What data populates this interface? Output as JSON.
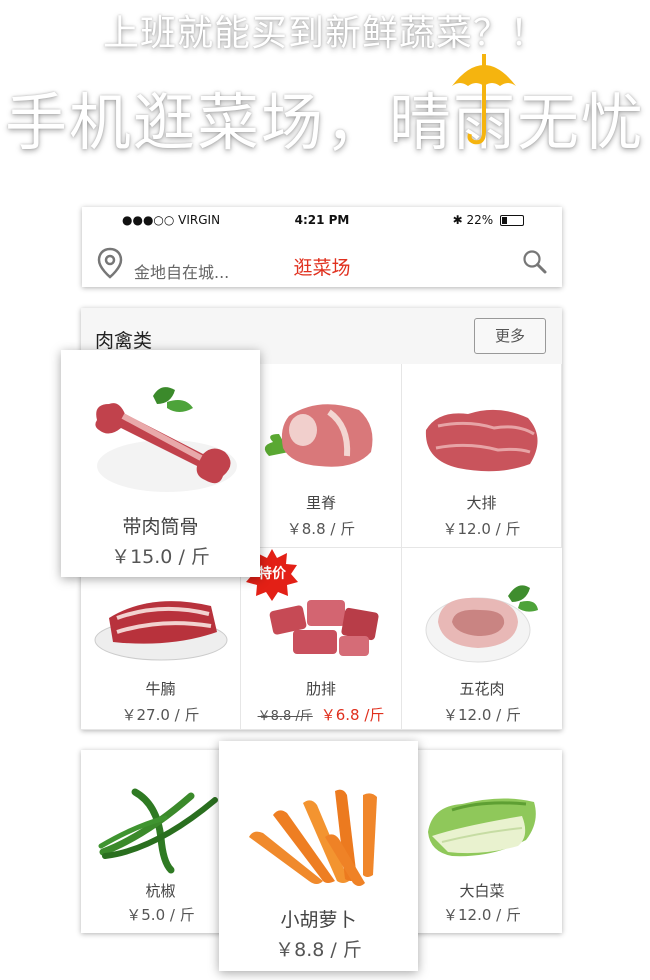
{
  "banner": {
    "line1": "上班就能买到新鲜蔬菜？！",
    "line2": "手机逛菜场，晴雨无忧"
  },
  "status_bar": {
    "carrier": "●●●○○ VIRGIN",
    "time": "4:21 PM",
    "battery": "22%"
  },
  "nav": {
    "location_text": "金地自在城...",
    "title": "逛菜场"
  },
  "meat": {
    "category": "肉禽类",
    "more_label": "更多",
    "featured": {
      "name": "带肉筒骨",
      "price": "￥15.0  / 斤"
    },
    "items": [
      {
        "name": "里脊",
        "price": "￥8.8  / 斤"
      },
      {
        "name": "大排",
        "price": "￥12.0  / 斤"
      },
      {
        "name": "牛腩",
        "price": "￥27.0  / 斤"
      },
      {
        "name": "肋排",
        "old_price": "￥8.8 /斤",
        "new_price": "￥6.8 /斤",
        "badge": "特价"
      },
      {
        "name": "五花肉",
        "price": "￥12.0  / 斤"
      }
    ]
  },
  "veg": {
    "items": [
      {
        "name": "杭椒",
        "price": "￥5.0  / 斤"
      },
      {
        "name": "大白菜",
        "price": "￥12.0  / 斤"
      }
    ],
    "featured": {
      "name": "小胡萝卜",
      "price": "￥8.8  / 斤"
    }
  },
  "colors": {
    "accent": "#e0301e",
    "umbrella": "#f5b40f"
  }
}
